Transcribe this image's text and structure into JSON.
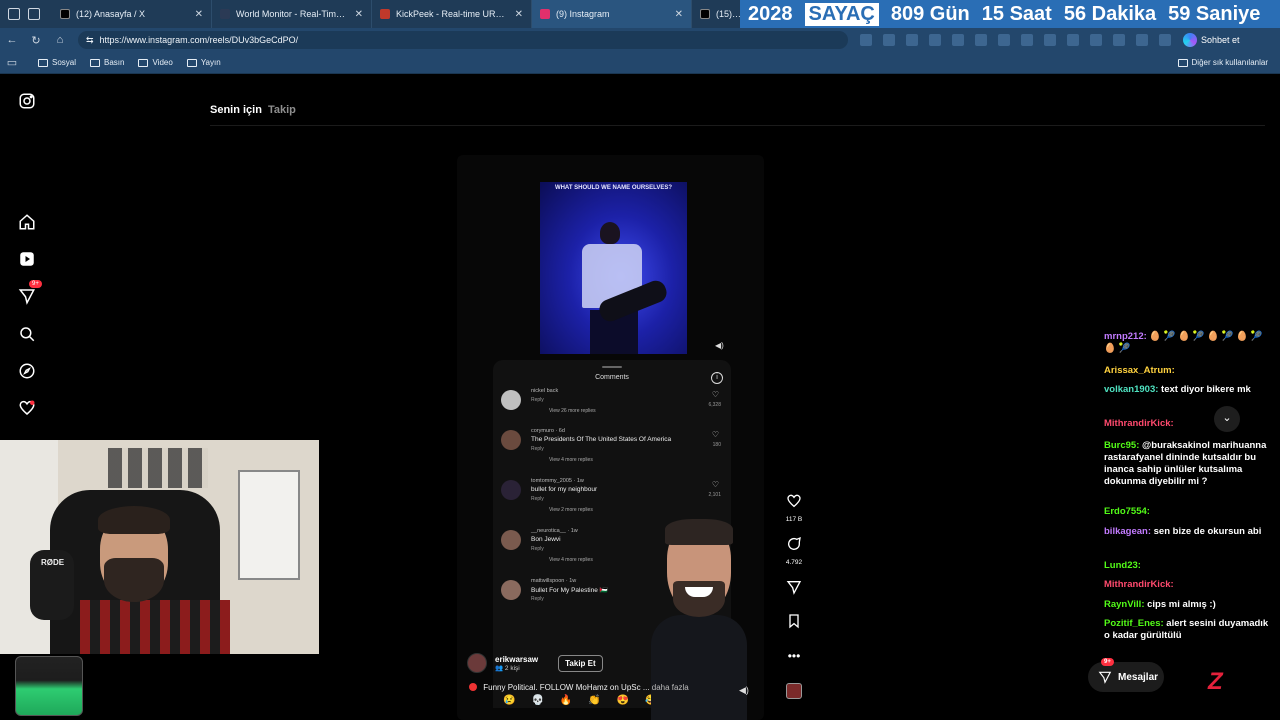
{
  "browser": {
    "tabs": [
      {
        "title": "(12) Anasayfa / X",
        "favicon_color": "#000000"
      },
      {
        "title": "World Monitor - Real-Time Global",
        "favicon_color": "#2b3a55"
      },
      {
        "title": "KickPeek - Real-time URL Crawler",
        "favicon_color": "#c0392b"
      },
      {
        "title": "(9) Instagram",
        "favicon_color": "#e1306c",
        "active": true
      },
      {
        "title": "(15) Ana",
        "favicon_color": "#000000"
      }
    ],
    "counter": {
      "year": "2028",
      "label": "SAYAÇ",
      "days": "809 Gün",
      "hours": "15 Saat",
      "minutes": "56 Dakika",
      "seconds": "59 Saniye"
    },
    "url": "https://www.instagram.com/reels/DUv3bGeCdPO/",
    "chat_button": "Sohbet et",
    "bookmarks": [
      "Sosyal",
      "Basın",
      "Video",
      "Yayın"
    ],
    "other_bookmarks": "Diğer sık kullanılanlar"
  },
  "instagram": {
    "nav_badge": "9+",
    "tabs": {
      "for_you": "Senin için",
      "following": "Takip"
    },
    "reel": {
      "video_caption": "WHAT SHOULD WE NAME OURSELVES?",
      "comments_title": "Comments",
      "comments": [
        {
          "user": "nickel back",
          "text": "",
          "reply": "Reply",
          "more": "View 26 more replies",
          "likes": "6,328"
        },
        {
          "user": "corymuro · 6d",
          "text": "The Presidents Of The United States Of America",
          "reply": "Reply",
          "more": "View 4 more replies",
          "likes": "180"
        },
        {
          "user": "tomtommy_2005 · 1w",
          "text": "bullet for my neighbour",
          "reply": "Reply",
          "more": "View 2 more replies",
          "likes": "2,101"
        },
        {
          "user": "__neurotica__ · 1w",
          "text": "Bon Jewvi",
          "reply": "Reply",
          "more": "View 4 more replies",
          "likes": ""
        },
        {
          "user": "mattwillspoon · 1w",
          "text": "Bullet For My Palestine 🇵🇸",
          "reply": "Reply",
          "more": "",
          "likes": ""
        }
      ],
      "emojis": [
        "😢",
        "💀",
        "🔥",
        "👏",
        "😍",
        "😂"
      ],
      "author": "erikwarsaw",
      "author_sub": "👥 2 kişi",
      "follow": "Takip Et",
      "caption": "Funny Political. FOLLOW MoHamz on UpSc ...",
      "caption_more": "daha fazla"
    },
    "actions": {
      "likes": "117 B",
      "comments": "4.792"
    },
    "messages": {
      "label": "Mesajlar",
      "badge": "9+"
    }
  },
  "webcam": {
    "mic_brand": "RØDE"
  },
  "chat": [
    {
      "user": "mrnp212:",
      "text": "🥚 🎾 🥚 🎾 🥚 🎾 🥚 🎾 🥚 🎾",
      "color": "u-purple"
    },
    {
      "user": "Arissax_Atrum:",
      "text": "",
      "color": "u-yellow"
    },
    {
      "user": "volkan1903:",
      "text": "text diyor bikere mk",
      "color": "u-teal"
    },
    {
      "user": "MithrandirKick:",
      "text": "",
      "color": "u-red"
    },
    {
      "user": "Burc95:",
      "text": "@buraksakinol marihuanna rastarafyanel dininde kutsaldır bu inanca sahip ünlüler kutsalıma dokunma diyebilir mi ?",
      "color": "u-green"
    },
    {
      "user": "Erdo7554:",
      "text": "",
      "color": "u-green"
    },
    {
      "user": "bilkagean:",
      "text": "sen bize de okursun abi",
      "color": "u-purple"
    },
    {
      "user": "Lund23:",
      "text": "",
      "color": "u-green"
    },
    {
      "user": "MithrandirKick:",
      "text": "",
      "color": "u-red"
    },
    {
      "user": "RaynVill:",
      "text": "cips mi almış :)",
      "color": "u-green"
    },
    {
      "user": "Pozitif_Enes:",
      "text": "alert sesini duyamadık o kadar gürültülü",
      "color": "u-green"
    }
  ]
}
